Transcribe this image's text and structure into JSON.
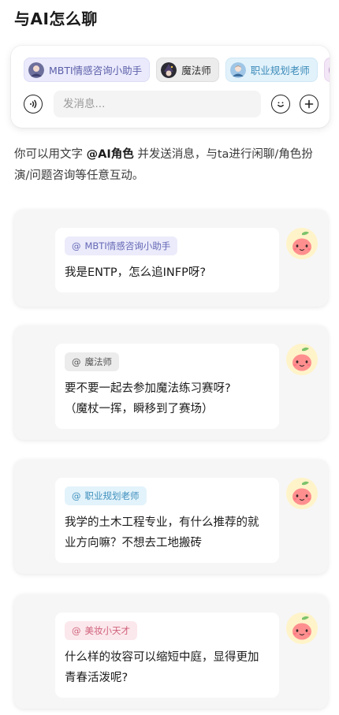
{
  "page": {
    "title": "与AI怎么聊"
  },
  "composer": {
    "characters": [
      {
        "name": "MBTI情感咨询小助手",
        "icon": "mbti-avatar"
      },
      {
        "name": "魔法师",
        "icon": "wizard-avatar"
      },
      {
        "name": "职业规划老师",
        "icon": "career-avatar"
      }
    ],
    "input_placeholder": "发消息..."
  },
  "intro": {
    "before": "你可以用文字 ",
    "highlight": "@AI角色",
    "after": " 并发送消息，与ta进行闲聊/角色扮演/问题咨询等任意互动。"
  },
  "examples": [
    {
      "at": "@",
      "character": "MBTI情感咨询小助手",
      "question": "我是ENTP，怎么追INFP呀?"
    },
    {
      "at": "@",
      "character": "魔法师",
      "question": "要不要一起去参加魔法练习赛呀?\n（魔杖一挥，瞬移到了赛场）"
    },
    {
      "at": "@",
      "character": "职业规划老师",
      "question": "我学的土木工程专业，有什么推荐的就业方向嘛？不想去工地搬砖"
    },
    {
      "at": "@",
      "character": "美妆小天才",
      "question": "什么样的妆容可以缩短中庭，显得更加青春活泼呢?"
    }
  ],
  "colors": {
    "mbti": "#6467b5",
    "magic": "#555555",
    "career": "#3e8fbd",
    "beauty": "#d0607a",
    "card_bg": "#f6f6f6"
  }
}
